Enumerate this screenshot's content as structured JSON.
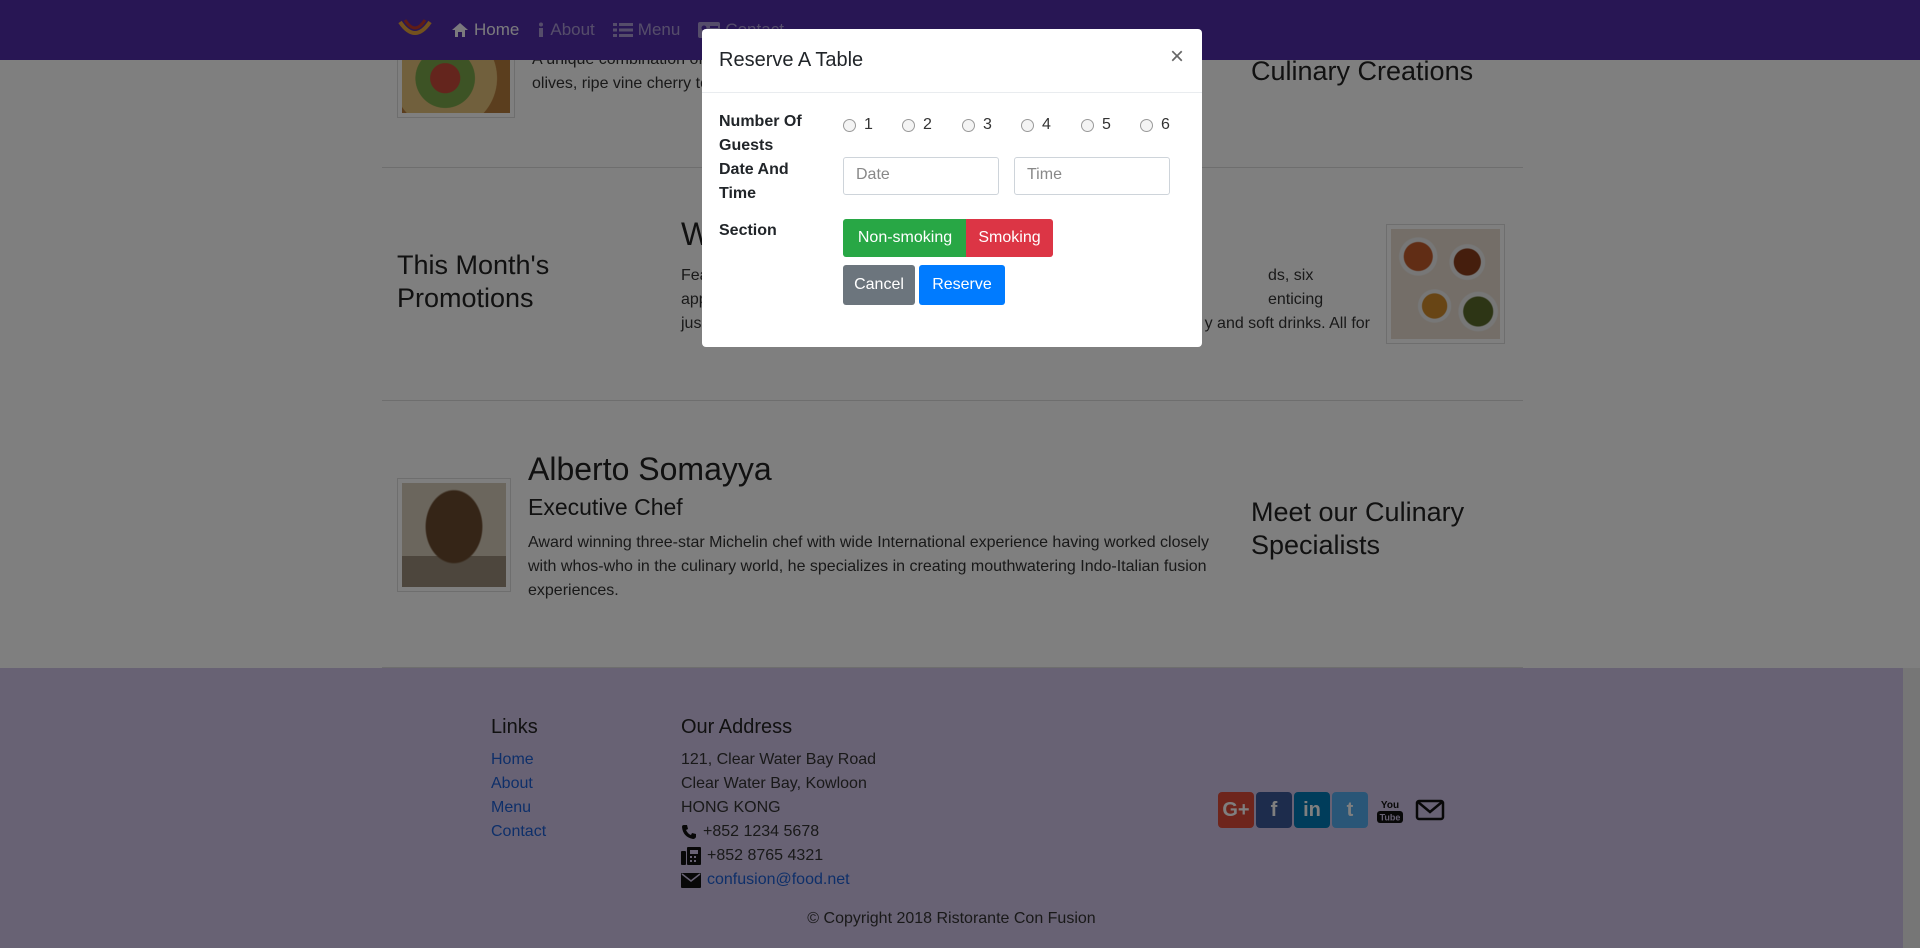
{
  "nav": {
    "items": [
      {
        "label": "Home",
        "icon": "home-icon"
      },
      {
        "label": "About",
        "icon": "info-icon"
      },
      {
        "label": "Menu",
        "icon": "list-icon"
      },
      {
        "label": "Contact",
        "icon": "address-card-icon"
      }
    ]
  },
  "dish": {
    "text_line1": "A unique combination of",
    "text_line2": "olives, ripe vine cherry to",
    "side_heading": "Culinary Creations"
  },
  "promotion": {
    "side_heading": "This Month's Promotions",
    "title_partial": "W",
    "line1_left": "Fea",
    "line1_right": "ds, six enticing",
    "line2_left": "app",
    "line2_right": "y and soft drinks. All for",
    "line3_left": "jus"
  },
  "leader": {
    "name": "Alberto Somayya",
    "role": "Executive Chef",
    "description": "Award winning three-star Michelin chef with wide International experience having worked closely with whos-who in the culinary world, he specializes in creating mouthwatering Indo-Italian fusion experiences.",
    "side_heading": "Meet our Culinary Specialists"
  },
  "footer": {
    "links_heading": "Links",
    "links": [
      "Home",
      "About",
      "Menu",
      "Contact"
    ],
    "address_heading": "Our Address",
    "address": [
      "121, Clear Water Bay Road",
      "Clear Water Bay, Kowloon",
      "HONG KONG"
    ],
    "phone": "+852 1234 5678",
    "fax": "+852 8765 4321",
    "email": "confusion@food.net",
    "copyright": "© Copyright 2018 Ristorante Con Fusion",
    "social": [
      {
        "name": "google-plus",
        "glyph": "G+",
        "color": "#dd4b39"
      },
      {
        "name": "facebook",
        "glyph": "f",
        "color": "#3b5998"
      },
      {
        "name": "linkedin",
        "glyph": "in",
        "color": "#007bb6"
      },
      {
        "name": "twitter",
        "glyph": "t",
        "color": "#55acee"
      }
    ]
  },
  "modal": {
    "title": "Reserve A Table",
    "close": "×",
    "guests_label_1": "Number Of",
    "guests_label_2": "Guests",
    "guest_options": [
      "1",
      "2",
      "3",
      "4",
      "5",
      "6"
    ],
    "datetime_label_1": "Date And",
    "datetime_label_2": "Time",
    "date_placeholder": "Date",
    "time_placeholder": "Time",
    "section_label": "Section",
    "non_smoking": "Non-smoking",
    "smoking": "Smoking",
    "cancel": "Cancel",
    "reserve": "Reserve"
  },
  "colors": {
    "navbar": "#512da8",
    "footer": "#d1c4e9",
    "non_smoking": "#28a745",
    "smoking": "#dc3545",
    "cancel": "#6c757d",
    "reserve": "#007bff"
  }
}
